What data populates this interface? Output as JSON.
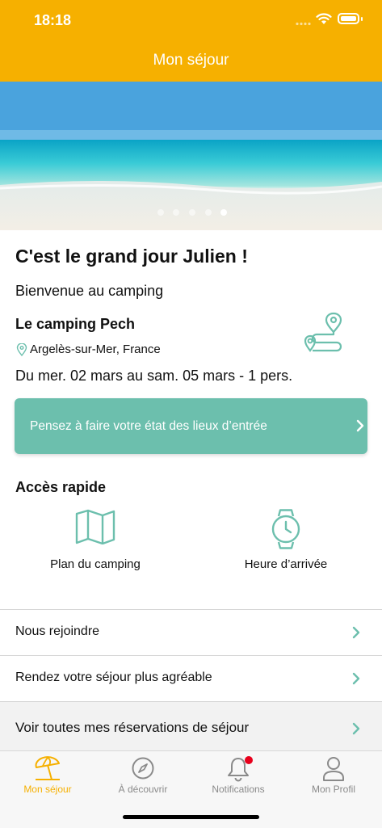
{
  "status_bar": {
    "time": "18:18"
  },
  "header": {
    "title": "Mon séjour"
  },
  "carousel": {
    "count": 5,
    "active_index": 4
  },
  "welcome": {
    "greeting": "C'est le grand jour Julien !",
    "subtitle": "Bienvenue au camping",
    "camping_name": "Le camping Pech",
    "location": "Argelès-sur-Mer, France",
    "dates": "Du mer. 02 mars au sam. 05 mars - 1 pers."
  },
  "banner": {
    "text": "Pensez à faire votre état des lieux d’entrée"
  },
  "quick_access": {
    "title": "Accès rapide",
    "items": [
      {
        "label": "Plan du camping",
        "icon": "map-icon"
      },
      {
        "label": "Heure d’arrivée",
        "icon": "watch-icon"
      }
    ]
  },
  "list": [
    {
      "label": "Nous rejoindre"
    },
    {
      "label": "Rendez votre séjour plus agréable"
    },
    {
      "label": "Voir toutes mes réservations de séjour"
    }
  ],
  "tabbar": [
    {
      "label": "Mon séjour",
      "icon": "beach-umbrella-icon",
      "active": true
    },
    {
      "label": "À découvrir",
      "icon": "compass-icon"
    },
    {
      "label": "Notifications",
      "icon": "bell-icon",
      "badge": true
    },
    {
      "label": "Mon Profil",
      "icon": "user-icon"
    }
  ],
  "colors": {
    "primary": "#F6B000",
    "teal": "#6CBFAD",
    "badge": "#E8001C"
  }
}
